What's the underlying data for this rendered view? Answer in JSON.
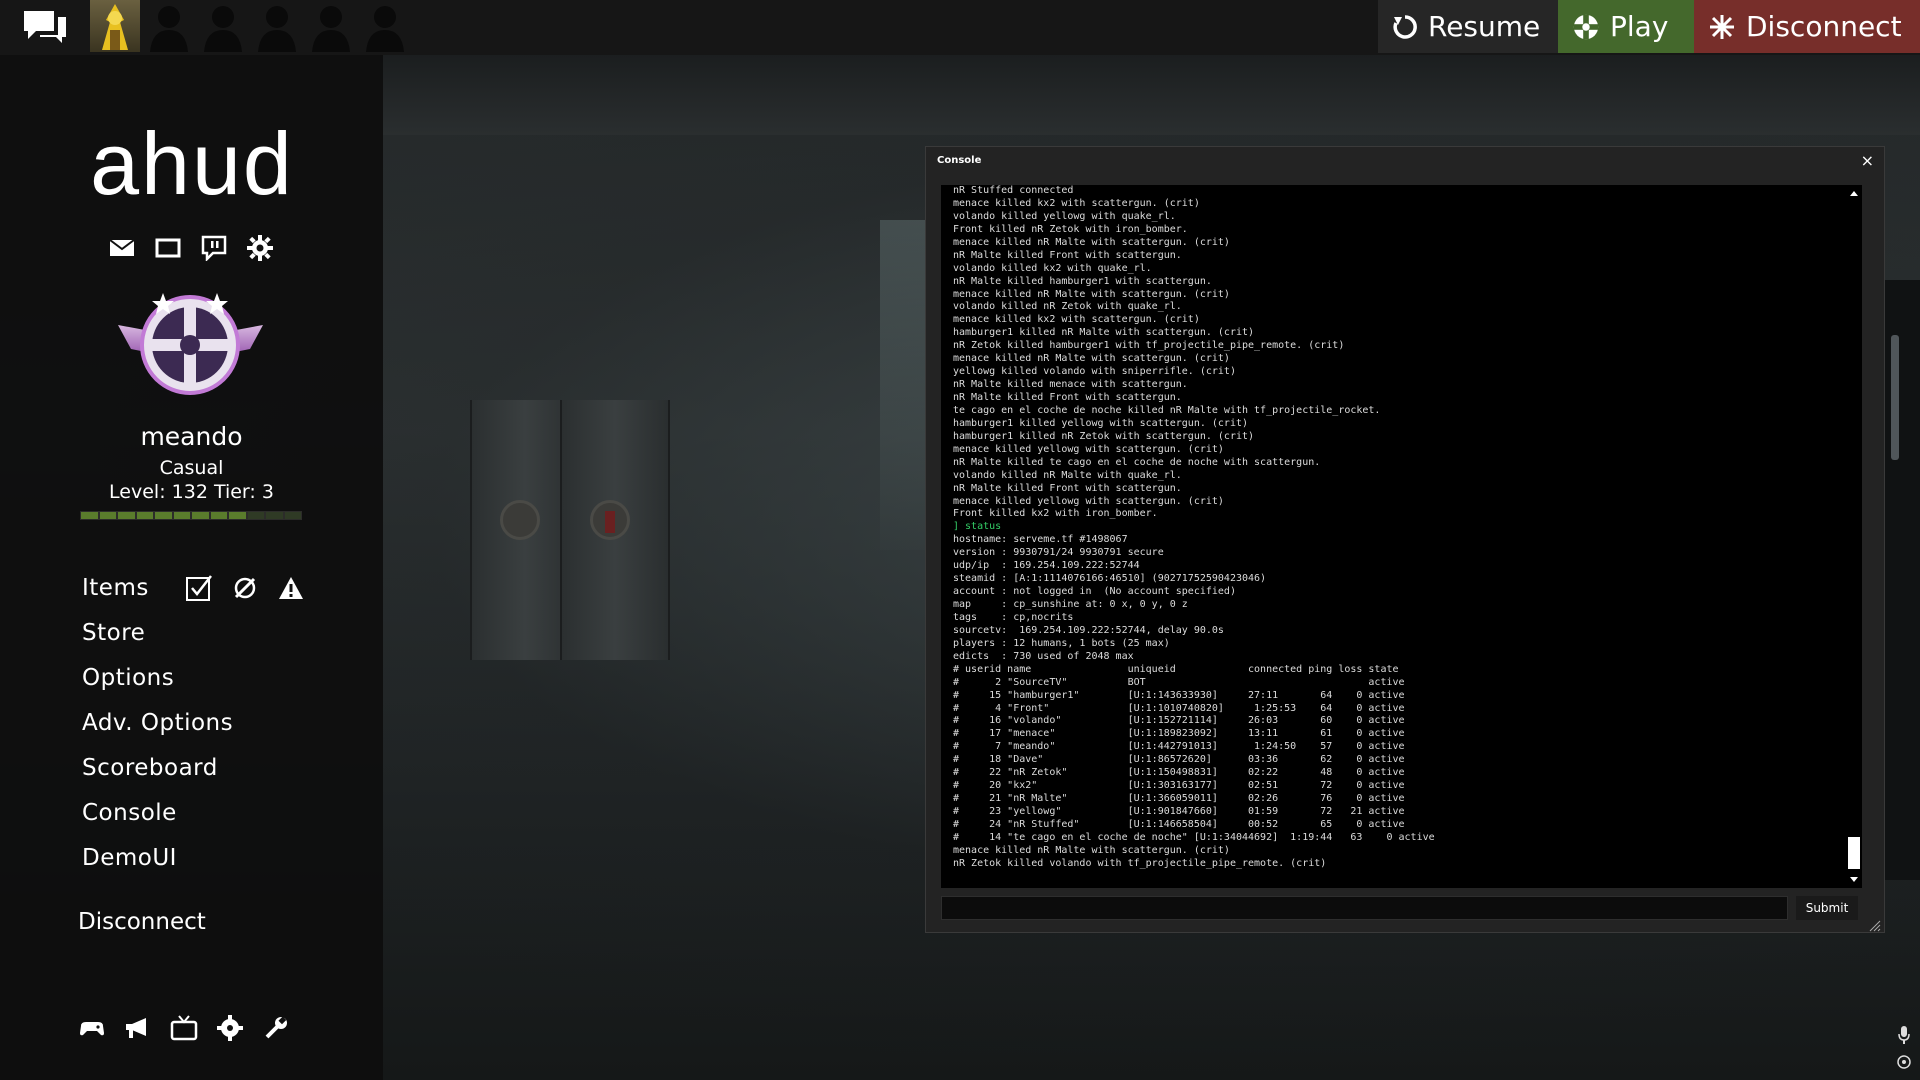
{
  "top_bar": {
    "resume_label": "Resume",
    "play_label": "Play",
    "disconnect_label": "Disconnect",
    "friend_slots": 6
  },
  "sidebar": {
    "logo": "ahud",
    "player_name": "meando",
    "mode": "Casual",
    "level_text": "Level: 132 Tier: 3",
    "xp_segments_filled": 9,
    "xp_segments_total": 12,
    "menu": [
      {
        "label": "Items"
      },
      {
        "label": "Store"
      },
      {
        "label": "Options"
      },
      {
        "label": "Adv. Options"
      },
      {
        "label": "Scoreboard"
      },
      {
        "label": "Console"
      },
      {
        "label": "DemoUI"
      }
    ],
    "disconnect_label": "Disconnect"
  },
  "console": {
    "title": "Console",
    "close_label": "×",
    "submit_label": "Submit",
    "input_value": "",
    "lines": [
      {
        "text": "nR Stuffed connected",
        "kind": "normal"
      },
      {
        "text": "menace killed kx2 with scattergun. (crit)",
        "kind": "normal"
      },
      {
        "text": "volando killed yellowg with quake_rl.",
        "kind": "normal"
      },
      {
        "text": "Front killed nR Zetok with iron_bomber.",
        "kind": "normal"
      },
      {
        "text": "menace killed nR Malte with scattergun. (crit)",
        "kind": "normal"
      },
      {
        "text": "nR Malte killed Front with scattergun.",
        "kind": "normal"
      },
      {
        "text": "volando killed kx2 with quake_rl.",
        "kind": "normal"
      },
      {
        "text": "nR Malte killed hamburger1 with scattergun.",
        "kind": "normal"
      },
      {
        "text": "menace killed nR Malte with scattergun. (crit)",
        "kind": "normal"
      },
      {
        "text": "volando killed nR Zetok with quake_rl.",
        "kind": "normal"
      },
      {
        "text": "menace killed kx2 with scattergun. (crit)",
        "kind": "normal"
      },
      {
        "text": "hamburger1 killed nR Malte with scattergun. (crit)",
        "kind": "normal"
      },
      {
        "text": "nR Zetok killed hamburger1 with tf_projectile_pipe_remote. (crit)",
        "kind": "normal"
      },
      {
        "text": "menace killed nR Malte with scattergun. (crit)",
        "kind": "normal"
      },
      {
        "text": "yellowg killed volando with sniperrifle. (crit)",
        "kind": "normal"
      },
      {
        "text": "nR Malte killed menace with scattergun.",
        "kind": "normal"
      },
      {
        "text": "nR Malte killed Front with scattergun.",
        "kind": "normal"
      },
      {
        "text": "te cago en el coche de noche killed nR Malte with tf_projectile_rocket.",
        "kind": "normal"
      },
      {
        "text": "hamburger1 killed yellowg with scattergun. (crit)",
        "kind": "normal"
      },
      {
        "text": "hamburger1 killed nR Zetok with scattergun. (crit)",
        "kind": "normal"
      },
      {
        "text": "menace killed yellowg with scattergun. (crit)",
        "kind": "normal"
      },
      {
        "text": "nR Malte killed te cago en el coche de noche with scattergun.",
        "kind": "normal"
      },
      {
        "text": "volando killed nR Malte with quake_rl.",
        "kind": "normal"
      },
      {
        "text": "nR Malte killed Front with scattergun.",
        "kind": "normal"
      },
      {
        "text": "menace killed yellowg with scattergun. (crit)",
        "kind": "normal"
      },
      {
        "text": "Front killed kx2 with iron_bomber.",
        "kind": "normal"
      },
      {
        "text": "] status",
        "kind": "cmd"
      },
      {
        "text": "hostname: serveme.tf #1498067",
        "kind": "normal"
      },
      {
        "text": "version : 9930791/24 9930791 secure",
        "kind": "normal"
      },
      {
        "text": "udp/ip  : 169.254.109.222:52744",
        "kind": "normal"
      },
      {
        "text": "steamid : [A:1:1114076166:46510] (90271752590423046)",
        "kind": "normal"
      },
      {
        "text": "account : not logged in  (No account specified)",
        "kind": "normal"
      },
      {
        "text": "map     : cp_sunshine at: 0 x, 0 y, 0 z",
        "kind": "normal"
      },
      {
        "text": "tags    : cp,nocrits",
        "kind": "normal"
      },
      {
        "text": "sourcetv:  169.254.109.222:52744, delay 90.0s",
        "kind": "normal"
      },
      {
        "text": "players : 12 humans, 1 bots (25 max)",
        "kind": "normal"
      },
      {
        "text": "edicts  : 730 used of 2048 max",
        "kind": "normal"
      },
      {
        "text": "# userid name                uniqueid            connected ping loss state",
        "kind": "normal"
      },
      {
        "text": "#      2 \"SourceTV\"          BOT                                     active",
        "kind": "normal"
      },
      {
        "text": "#     15 \"hamburger1\"        [U:1:143633930]     27:11       64    0 active",
        "kind": "normal"
      },
      {
        "text": "#      4 \"Front\"             [U:1:1010740820]     1:25:53    64    0 active",
        "kind": "normal"
      },
      {
        "text": "#     16 \"volando\"           [U:1:152721114]     26:03       60    0 active",
        "kind": "normal"
      },
      {
        "text": "#     17 \"menace\"            [U:1:189823092]     13:11       61    0 active",
        "kind": "normal"
      },
      {
        "text": "#      7 \"meando\"            [U:1:442791013]      1:24:50    57    0 active",
        "kind": "normal"
      },
      {
        "text": "#     18 \"Dave\"              [U:1:86572620]      03:36       62    0 active",
        "kind": "normal"
      },
      {
        "text": "#     22 \"nR Zetok\"          [U:1:150498831]     02:22       48    0 active",
        "kind": "normal"
      },
      {
        "text": "#     20 \"kx2\"               [U:1:303163177]     02:51       72    0 active",
        "kind": "normal"
      },
      {
        "text": "#     21 \"nR Malte\"          [U:1:366059011]     02:26       76    0 active",
        "kind": "normal"
      },
      {
        "text": "#     23 \"yellowg\"           [U:1:901847660]     01:59       72   21 active",
        "kind": "normal"
      },
      {
        "text": "#     24 \"nR Stuffed\"        [U:1:146658504]     00:52       65    0 active",
        "kind": "normal"
      },
      {
        "text": "#     14 \"te cago en el coche de noche\" [U:1:34044692]  1:19:44   63    0 active",
        "kind": "normal"
      },
      {
        "text": "menace killed nR Malte with scattergun. (crit)",
        "kind": "normal"
      },
      {
        "text": "nR Zetok killed volando with tf_projectile_pipe_remote. (crit)",
        "kind": "normal"
      }
    ]
  },
  "icons": {
    "chat": "chat-bubbles-icon",
    "resume": "refresh-icon",
    "play": "play-icon",
    "disconnect": "burst-icon"
  },
  "colors": {
    "play_bg": "#44682c",
    "disconnect_bg": "#772e2a",
    "resume_bg": "#262626",
    "xp_fill": "#5a7c2c",
    "console_cmd": "#33cc66"
  }
}
